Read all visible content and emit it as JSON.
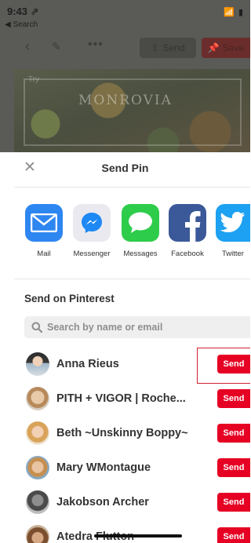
{
  "status_bar": {
    "time": "9:43 ⇗",
    "back_app": "◀ Search",
    "icons": "📶 ▮"
  },
  "pin_toolbar": {
    "back_glyph": "‹",
    "edit_glyph": "✎",
    "more_glyph": "•••",
    "send_label": "Send",
    "save_label": "Save"
  },
  "pin": {
    "brand_text": "MONROVIA",
    "try_label": "Try"
  },
  "sheet": {
    "close_glyph": "✕",
    "title": "Send Pin",
    "apps": [
      {
        "label": "Mail",
        "icon": "mail-icon",
        "color": "#2e86f0"
      },
      {
        "label": "Messenger",
        "icon": "messenger-icon",
        "color": "#e9e9ef"
      },
      {
        "label": "Messages",
        "icon": "messages-icon",
        "color": "#2ecc4b"
      },
      {
        "label": "Facebook",
        "icon": "facebook-icon",
        "color": "#3b5998"
      },
      {
        "label": "Twitter",
        "icon": "twitter-icon",
        "color": "#1da1f2"
      }
    ],
    "section_title": "Send on Pinterest",
    "search_placeholder": "Search by name or email",
    "contacts": [
      {
        "name": "Anna Rieus",
        "send_label": "Send"
      },
      {
        "name": "PITH + VIGOR  | Roche...",
        "send_label": "Send"
      },
      {
        "name": "Beth ~Unskinny Boppy~",
        "send_label": "Send"
      },
      {
        "name": "Mary WMontague",
        "send_label": "Send"
      },
      {
        "name": "Jakobson Archer",
        "send_label": "Send"
      },
      {
        "name": "Atedra Flutton",
        "send_label": "Send"
      }
    ]
  },
  "colors": {
    "accent": "#e60023",
    "highlight": "#d02030"
  }
}
